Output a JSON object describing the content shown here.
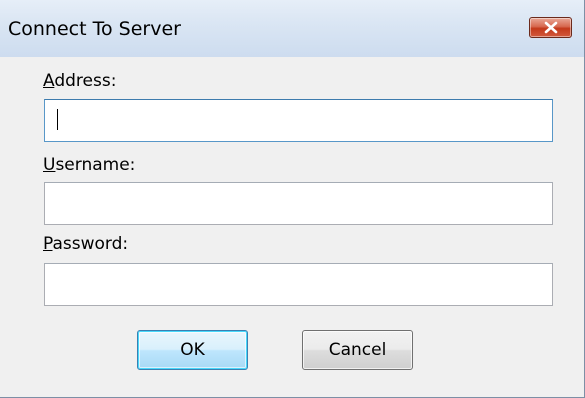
{
  "dialog": {
    "title": "Connect To Server",
    "close_icon": "close-icon"
  },
  "fields": {
    "address": {
      "label_mnemonic": "A",
      "label_rest": "ddress:",
      "value": ""
    },
    "username": {
      "label_mnemonic": "U",
      "label_rest": "sername:",
      "value": ""
    },
    "password": {
      "label_mnemonic": "P",
      "label_rest": "assword:",
      "value": ""
    }
  },
  "buttons": {
    "ok_label": "OK",
    "cancel_label": "Cancel"
  }
}
